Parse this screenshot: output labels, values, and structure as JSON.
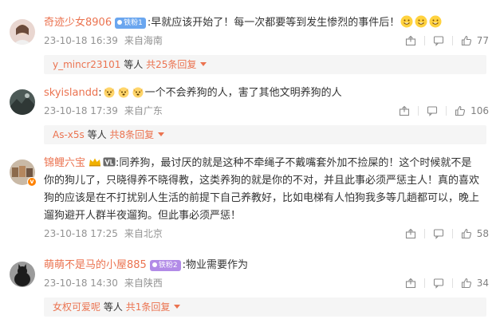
{
  "comments": [
    {
      "username": "奇迹少女8906",
      "badge": "铁粉1",
      "text": "早就应该开始了！每一次都要等到发生惨烈的事件后！",
      "emoji_count": 3,
      "time": "23-10-18 16:39",
      "location": "来自海南",
      "likes": "77",
      "reply_user": "y_mincr23101",
      "reply_mid": "等人",
      "reply_total": "共25条回复"
    },
    {
      "username": "skyislandd",
      "text": "一个不会养狗的人，害了其他文明养狗的人",
      "emoji_count": 3,
      "time": "23-10-18 17:39",
      "location": "来自广东",
      "likes": "106",
      "reply_user": "As-x5s",
      "reply_mid": "等人",
      "reply_total": "共8条回复"
    },
    {
      "username": "锦鲤六宝",
      "text_line1": "同养狗，最讨厌的就是这种不牵绳子不戴嘴套外加不捡屎的！这个时候就不是",
      "text_line2": "你的狗儿了，只晓得养不晓得教，这类养狗的就是你的不对，并且此事必须严惩主人！真的喜欢",
      "text_line3": "狗的应该是在不打扰别人生活的前提下自己养教好，比如电梯有人怕狗我多等几趟都可以，晚上",
      "text_line4": "遛狗避开人群半夜遛狗。但此事必须严惩！",
      "time": "23-10-18 17:25",
      "location": "来自北京",
      "likes": "58"
    },
    {
      "username": "萌萌不是马的小屋885",
      "badge": "铁粉2",
      "text": "物业需要作为",
      "time": "23-10-18 14:30",
      "location": "来自陕西",
      "likes": "34",
      "reply_user": "女权可爱呢",
      "reply_mid": "等人",
      "reply_total": "共1条回复"
    }
  ],
  "colors": {
    "accent": "#eb7350",
    "meta": "#939393",
    "replybg": "#f5f5f5"
  },
  "icons": [
    "share-icon",
    "comment-icon",
    "like-icon",
    "emoji-icon",
    "vip-crown-icon"
  ]
}
